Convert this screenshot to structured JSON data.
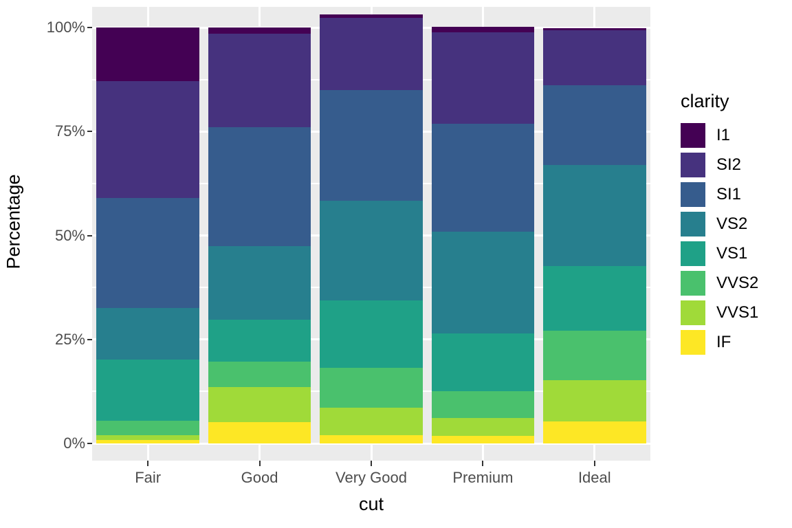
{
  "chart_data": {
    "type": "bar",
    "title": "",
    "subtitle": "",
    "stacked": true,
    "stack_mode": "percent",
    "xlabel": "cut",
    "ylabel": "Percentage",
    "categories": [
      "Fair",
      "Good",
      "Very Good",
      "Premium",
      "Ideal"
    ],
    "ylim": [
      0,
      100
    ],
    "y_ticks": [
      0,
      25,
      50,
      75,
      100
    ],
    "y_tick_labels": [
      "0%",
      "25%",
      "50%",
      "75%",
      "100%"
    ],
    "grid": true,
    "grid_color": "#ffffff",
    "panel_background": "#ebebeb",
    "legend_title": "clarity",
    "legend_position": "right",
    "series": [
      {
        "name": "I1",
        "color": "#440154",
        "values": [
          12.9,
          1.5,
          0.8,
          1.2,
          0.5
        ]
      },
      {
        "name": "SI2",
        "color": "#46327e",
        "values": [
          28.1,
          22.5,
          17.4,
          22.0,
          13.2
        ]
      },
      {
        "name": "SI1",
        "color": "#365c8d",
        "values": [
          26.4,
          28.5,
          26.6,
          26.0,
          19.3
        ]
      },
      {
        "name": "VS2",
        "color": "#277f8e",
        "values": [
          12.4,
          17.7,
          23.9,
          24.5,
          24.3
        ]
      },
      {
        "name": "VS1",
        "color": "#1fa187",
        "values": [
          14.7,
          10.2,
          16.2,
          13.9,
          15.5
        ]
      },
      {
        "name": "VVS2",
        "color": "#4ac16d",
        "values": [
          3.5,
          6.0,
          9.6,
          6.3,
          11.9
        ]
      },
      {
        "name": "VVS1",
        "color": "#a0da39",
        "values": [
          1.2,
          8.4,
          6.6,
          4.3,
          9.9
        ]
      },
      {
        "name": "IF",
        "color": "#fde725",
        "values": [
          0.8,
          5.2,
          2.0,
          1.9,
          5.3
        ]
      }
    ],
    "legend_entries": [
      {
        "label": "I1",
        "color": "#440154"
      },
      {
        "label": "SI2",
        "color": "#46327e"
      },
      {
        "label": "SI1",
        "color": "#365c8d"
      },
      {
        "label": "VS2",
        "color": "#277f8e"
      },
      {
        "label": "VS1",
        "color": "#1fa187"
      },
      {
        "label": "VVS2",
        "color": "#4ac16d"
      },
      {
        "label": "VVS1",
        "color": "#a0da39"
      },
      {
        "label": "IF",
        "color": "#fde725"
      }
    ]
  },
  "axes": {
    "y_title": "Percentage",
    "x_title": "cut",
    "y_labels": [
      "100%",
      "75%",
      "50%",
      "25%",
      "0%"
    ],
    "x_labels": [
      "Fair",
      "Good",
      "Very Good",
      "Premium",
      "Ideal"
    ]
  },
  "legend": {
    "title": "clarity",
    "items": [
      {
        "label": "I1"
      },
      {
        "label": "SI2"
      },
      {
        "label": "SI1"
      },
      {
        "label": "VS2"
      },
      {
        "label": "VS1"
      },
      {
        "label": "VVS2"
      },
      {
        "label": "VVS1"
      },
      {
        "label": "IF"
      }
    ]
  }
}
